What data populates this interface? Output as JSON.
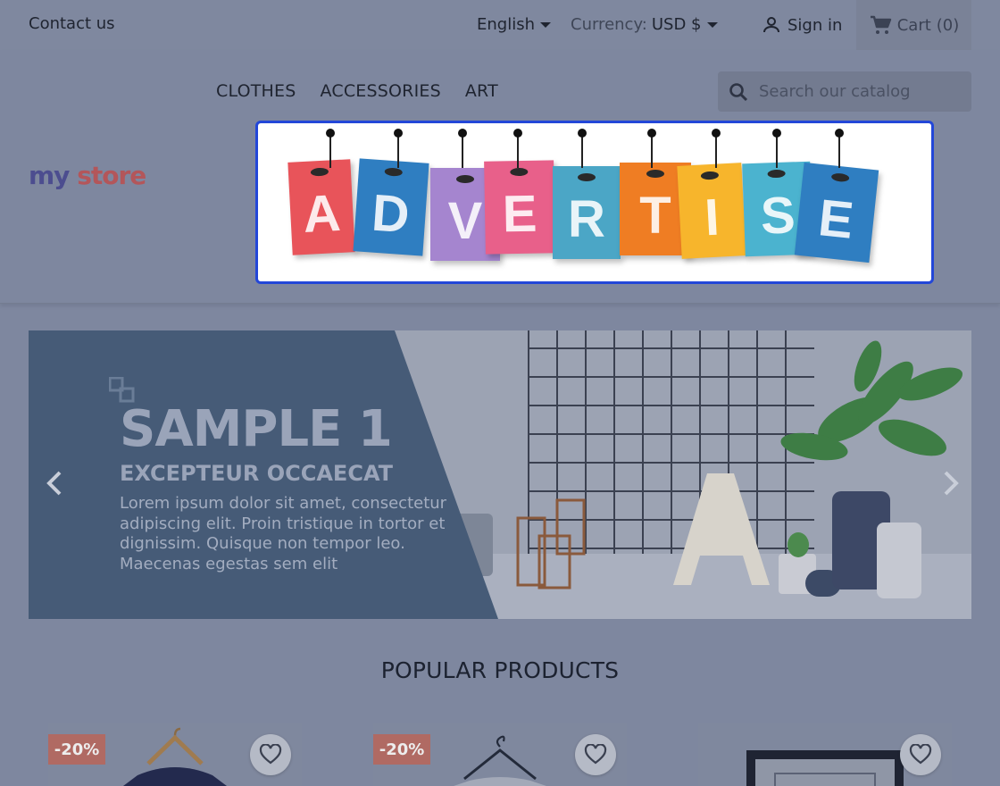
{
  "topbar": {
    "contact": "Contact us",
    "language": "English",
    "currency_label": "Currency:",
    "currency_value": "USD $",
    "signin": "Sign in",
    "cart": "Cart",
    "cart_count": "(0)"
  },
  "header": {
    "logo_part1": "my",
    "logo_part2": "store",
    "menu": [
      "CLOTHES",
      "ACCESSORIES",
      "ART"
    ],
    "search_placeholder": "Search our catalog",
    "banner_letters": [
      "A",
      "D",
      "V",
      "E",
      "R",
      "T",
      "I",
      "S",
      "E"
    ]
  },
  "slider": {
    "title": "SAMPLE 1",
    "subtitle": "EXCEPTEUR OCCAECAT",
    "text": "Lorem ipsum dolor sit amet, consectetur adipiscing elit. Proin tristique in tortor et dignissim. Quisque non tempor leo. Maecenas egestas sem elit"
  },
  "products": {
    "section_title": "POPULAR PRODUCTS",
    "items": [
      {
        "badge": "-20%",
        "image": "dark-tshirt-on-hanger"
      },
      {
        "badge": "-20%",
        "image": "white-tshirt-on-hanger"
      },
      {
        "badge": "",
        "image": "framed-poster"
      }
    ]
  },
  "colors": {
    "accent": "#2347d8",
    "overlay": "#7e879f",
    "slide_panel": "#465b77",
    "badge": "#b06a63",
    "banner_colors": [
      "#e8545a",
      "#2f7ec1",
      "#a585cf",
      "#e8608a",
      "#4ba6c6",
      "#ef7d23",
      "#f7b52c",
      "#4bb3cf",
      "#2f7ec1"
    ]
  }
}
